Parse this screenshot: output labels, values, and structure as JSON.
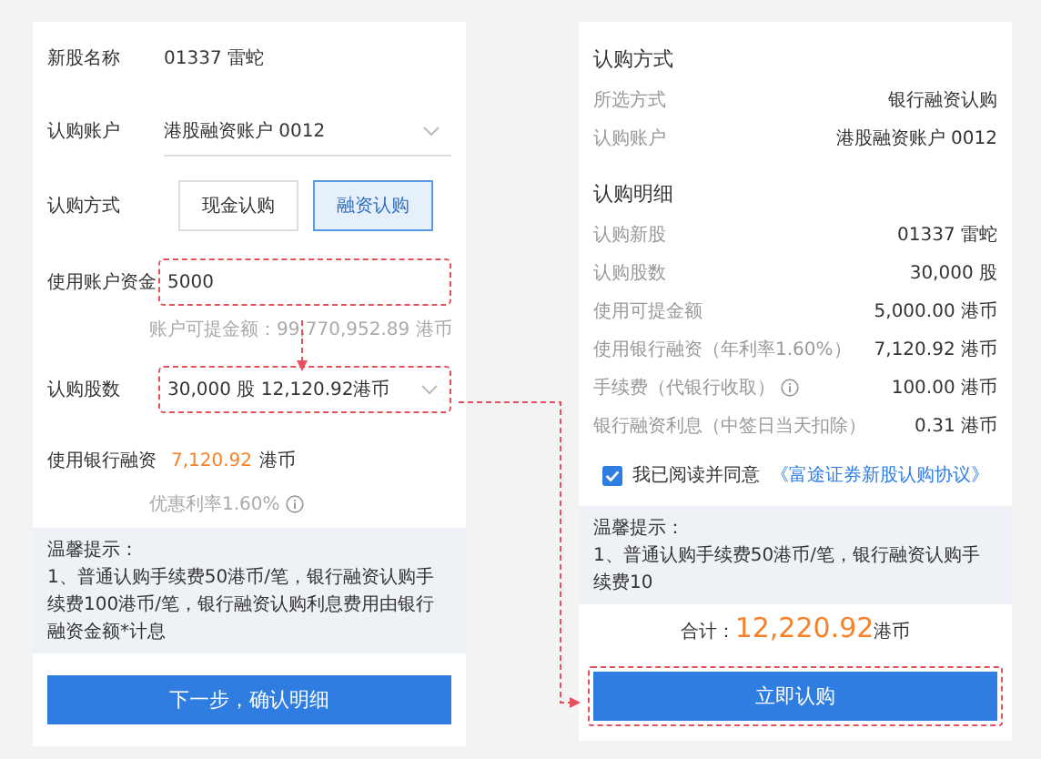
{
  "subscribe_form": {
    "stock": {
      "label": "新股名称",
      "value": "01337 雷蛇"
    },
    "account": {
      "label": "认购账户",
      "value": "港股融资账户 0012"
    },
    "method": {
      "label": "认购方式",
      "options": [
        {
          "label": "现金认购",
          "selected": false
        },
        {
          "label": "融资认购",
          "selected": true
        }
      ]
    },
    "cash": {
      "label": "使用账户资金",
      "value": "5000",
      "hint": "账户可提金额：99,770,952.89 港币",
      "highlighted": true
    },
    "shares": {
      "label": "认购股数",
      "value": "30,000 股 12,120.92港币",
      "highlighted": true
    },
    "financing": {
      "label": "使用银行融资",
      "amount": "7,120.92",
      "unit": "港币",
      "hint": "优惠利率1.60%"
    },
    "tips": {
      "title": "温馨提示：",
      "text": "1、普通认购手续费50港币/笔，银行融资认购手续费100港币/笔，银行融资认购利息费用由银行融资金额*计息"
    },
    "next_button": "下一步，确认明细"
  },
  "confirm_panel": {
    "sections": [
      {
        "heading": "认购方式",
        "rows": [
          {
            "label": "所选方式",
            "value": "银行融资认购",
            "info": false
          },
          {
            "label": "认购账户",
            "value": "港股融资账户 0012",
            "info": false
          }
        ]
      },
      {
        "heading": "认购明细",
        "rows": [
          {
            "label": "认购新股",
            "value": "01337 雷蛇",
            "info": false
          },
          {
            "label": "认购股数",
            "value": "30,000 股",
            "info": false
          },
          {
            "label": "使用可提金额",
            "value": "5,000.00 港币",
            "info": false
          },
          {
            "label": "使用银行融资（年利率1.60%）",
            "value": "7,120.92 港币",
            "info": false
          },
          {
            "label": "手续费（代银行收取）",
            "value": "100.00 港币",
            "info": true
          },
          {
            "label": "银行融资利息（中签日当天扣除）",
            "value": "0.31 港币",
            "info": false
          }
        ]
      }
    ],
    "agreement": {
      "checked": true,
      "text": "我已阅读并同意",
      "link": "《富途证券新股认购协议》"
    },
    "tips": {
      "title": "温馨提示：",
      "text": "1、普通认购手续费50港币/笔，银行融资认购手续费10"
    },
    "total": {
      "label": "合计：",
      "amount": "12,220.92",
      "unit": "港币"
    },
    "submit_button": {
      "label": "立即认购",
      "highlighted": true
    }
  }
}
